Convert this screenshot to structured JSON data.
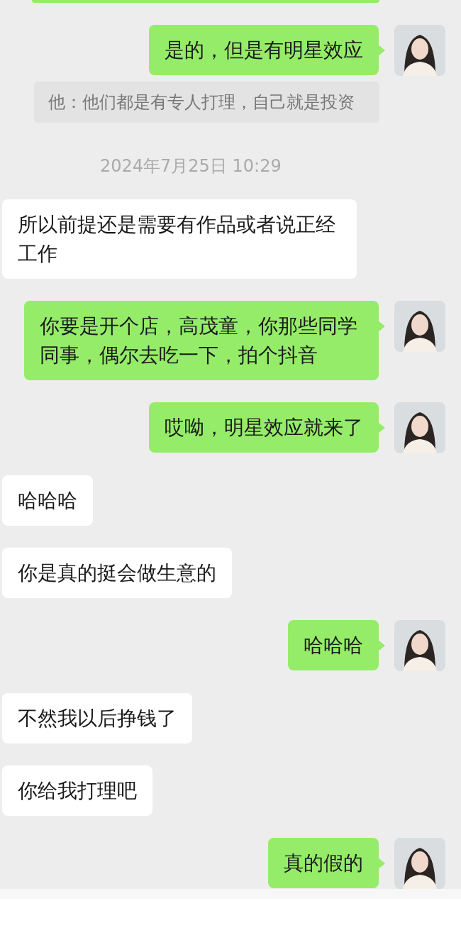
{
  "messages": [
    {
      "kind": "cut_sent"
    },
    {
      "kind": "sent",
      "text": "是的，但是有明星效应"
    },
    {
      "kind": "quote",
      "text": "他：他们都是有专人打理，自己就是投资"
    },
    {
      "kind": "time",
      "text": "2024年7月25日 10:29"
    },
    {
      "kind": "received",
      "text": "所以前提还是需要有作品或者说正经工作"
    },
    {
      "kind": "sent",
      "text": "你要是开个店，高茂童，你那些同学同事，偶尔去吃一下，拍个抖音"
    },
    {
      "kind": "sent",
      "text": "哎呦，明星效应就来了"
    },
    {
      "kind": "received",
      "text": "哈哈哈"
    },
    {
      "kind": "received",
      "text": "你是真的挺会做生意的"
    },
    {
      "kind": "sent",
      "text": "哈哈哈"
    },
    {
      "kind": "received",
      "text": "不然我以后挣钱了"
    },
    {
      "kind": "received",
      "text": "你给我打理吧"
    },
    {
      "kind": "sent",
      "text": "真的假的"
    }
  ]
}
